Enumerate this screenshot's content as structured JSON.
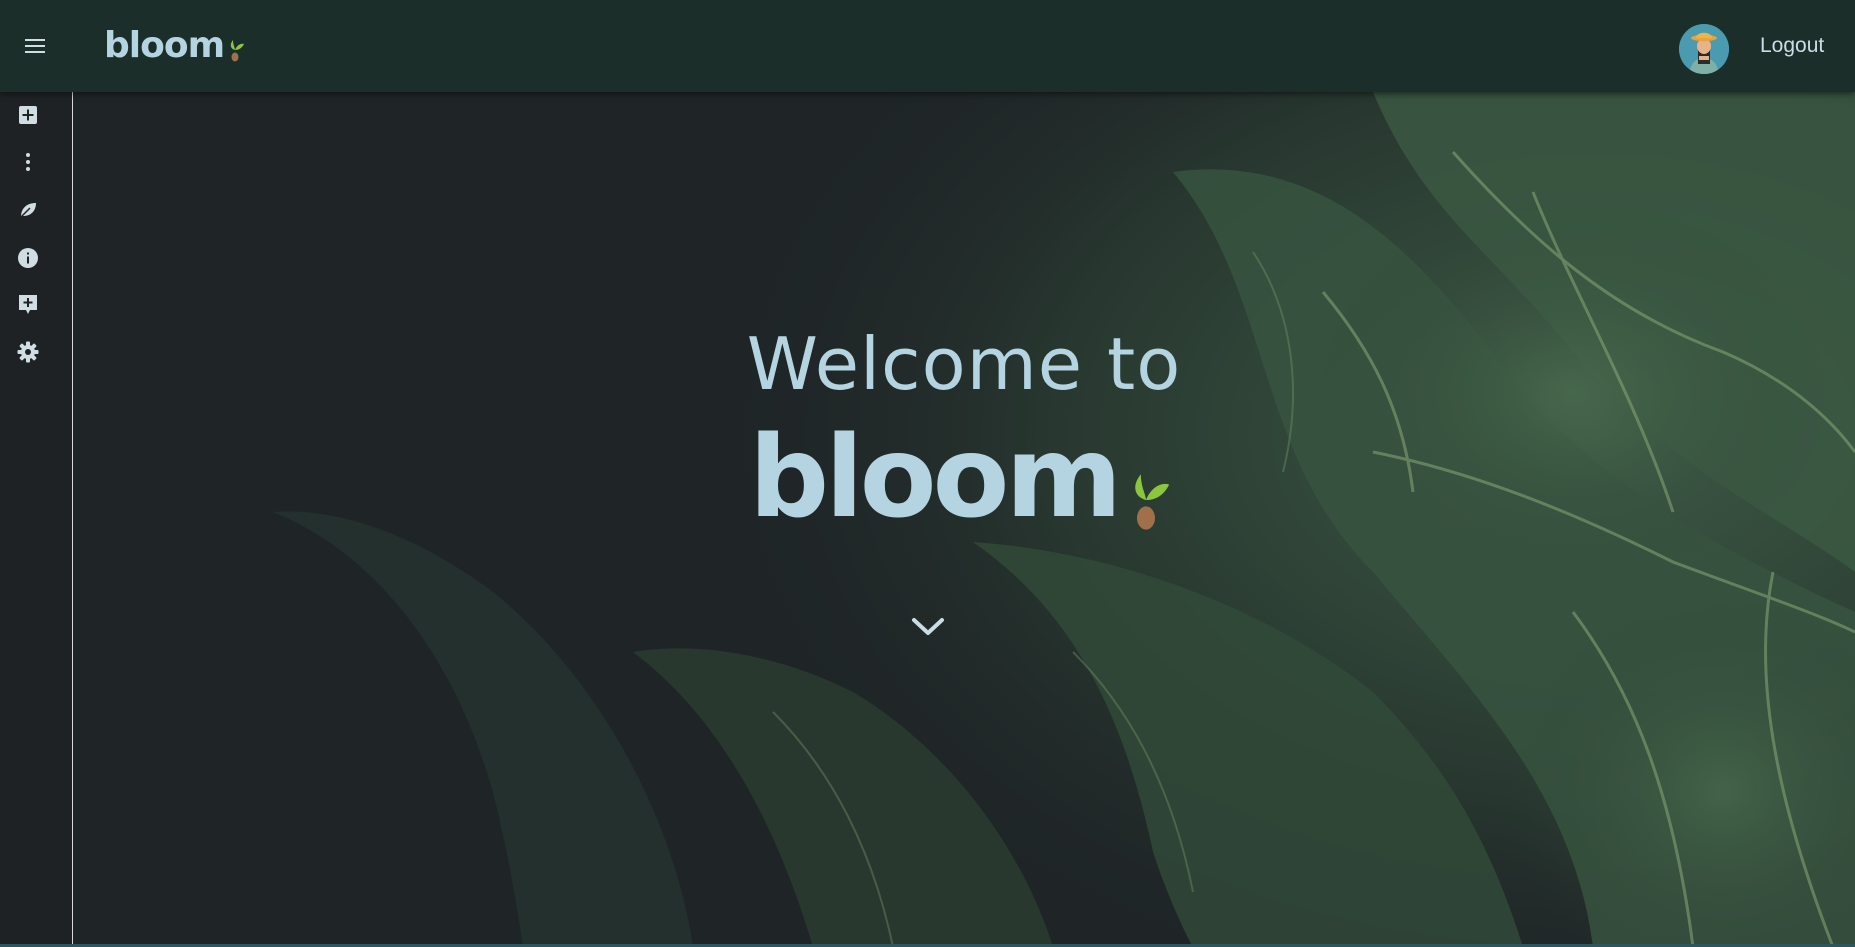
{
  "header": {
    "brand": "bloom",
    "logout_label": "Logout",
    "menu_icon": "hamburger-menu-icon",
    "avatar_icon": "user-avatar"
  },
  "sidebar": {
    "items": [
      {
        "icon": "add-box-icon"
      },
      {
        "icon": "more-vert-icon"
      },
      {
        "icon": "leaf-icon"
      },
      {
        "icon": "info-icon"
      },
      {
        "icon": "add-comment-icon"
      },
      {
        "icon": "settings-gear-icon"
      }
    ]
  },
  "hero": {
    "welcome": "Welcome to",
    "brand": "bloom",
    "scroll_icon": "chevron-down-icon"
  },
  "colors": {
    "header_bg": "#1c2e2a",
    "brand_text": "#b3d4e0",
    "sprout_green": "#8cc63f",
    "seed_brown": "#a0704a",
    "sidebar_bg": "#1e2224"
  }
}
